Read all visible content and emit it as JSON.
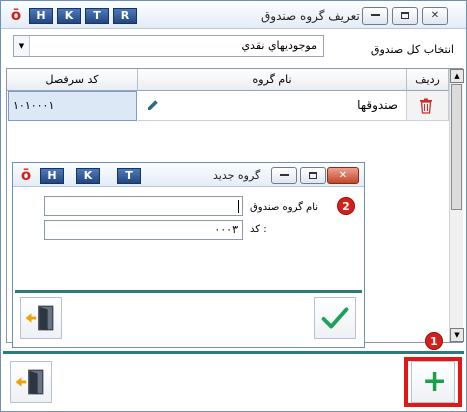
{
  "window": {
    "title": "تعريف گروه صندوق",
    "letters": [
      "H",
      "K",
      "T",
      "R"
    ],
    "logo": "ō"
  },
  "fund_category": {
    "label": "انتخاب کل صندوق",
    "selected": "موجوديهاي نقدي"
  },
  "grid": {
    "headers": {
      "row": "رديف",
      "group_name": "نام گروه",
      "ledger_code": "كد سرفصل"
    },
    "rows": [
      {
        "group_name": "صندوقها",
        "ledger_code": "۱۰۱۰۰۰۱"
      }
    ]
  },
  "badges": {
    "one": "1",
    "two": "2"
  },
  "dialog": {
    "title": "گروه جديد",
    "letters": [
      "H",
      "K",
      "T"
    ],
    "logo": "ō",
    "fields": {
      "name_label": "نام گروه صندوق",
      "name_value": "",
      "code_label": "كد :",
      "code_value": "۰۰۰۳"
    }
  },
  "colors": {
    "accent_teal": "#2c7b7a",
    "add_green": "#17a24a",
    "highlight_red": "#e01818",
    "confirm_green": "#1aa25a",
    "exit_orange": "#f2a100"
  }
}
